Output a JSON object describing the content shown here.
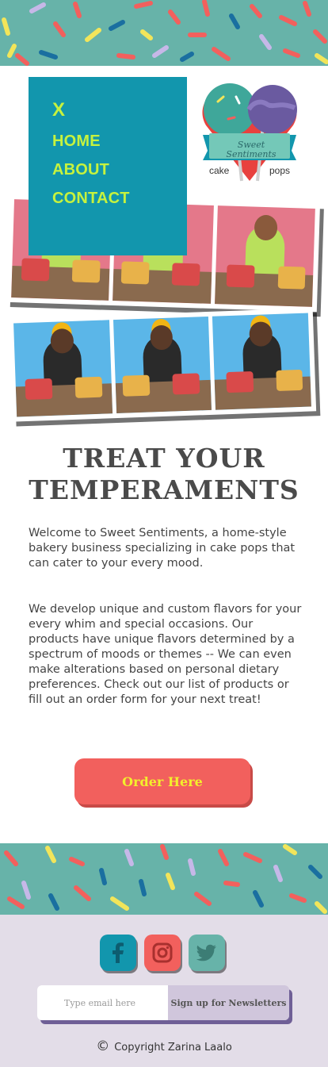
{
  "colors": {
    "teal_band": "#67b3a9",
    "menu_bg": "#1296ad",
    "menu_text": "#c6f23e",
    "order_button": "#f2605d",
    "order_text": "#f3ef2c",
    "footer_bg": "#e3dde8",
    "headline": "#4a4a4a"
  },
  "menu": {
    "close_label": "X",
    "items": [
      {
        "label": "HOME"
      },
      {
        "label": "ABOUT"
      },
      {
        "label": "CONTACT"
      }
    ]
  },
  "logo": {
    "line1": "Sweet",
    "line2": "Sentiments",
    "left_word": "cake",
    "right_word": "pops"
  },
  "hero": {
    "headline_line1": "TREAT YOUR",
    "headline_line2": "TEMPERAMENTS",
    "intro": "Welcome to Sweet Sentiments, a home-style bakery business specializing in cake pops that can cater to your every mood.",
    "details": "We develop unique and custom flavors for your every whim and special occasions. Our products have unique flavors determined by a spectrum of moods or themes -- We can even make alterations based on personal dietary preferences. Check out our list of products or fill out an order form for your next treat!",
    "order_button": "Order Here"
  },
  "footer": {
    "social": [
      {
        "icon": "facebook-icon"
      },
      {
        "icon": "instagram-icon"
      },
      {
        "icon": "twitter-icon"
      }
    ],
    "email_placeholder": "Type email here",
    "signup_label": "Sign up for Newsletters",
    "copyright_symbol": "©",
    "copyright_text": "Copyright Zarina Laalo"
  }
}
